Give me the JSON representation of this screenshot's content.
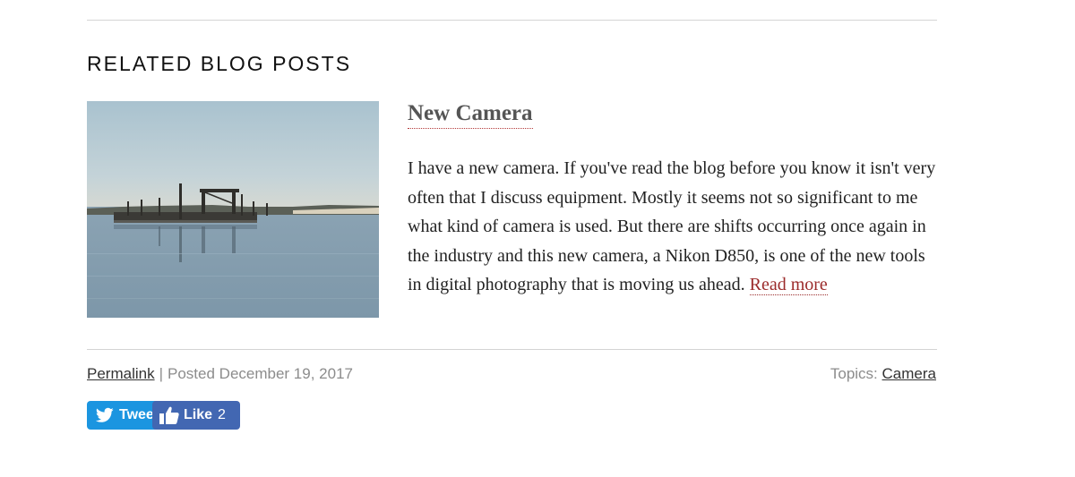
{
  "related": {
    "heading": "RELATED BLOG POSTS"
  },
  "post": {
    "title": "New Camera",
    "image_subject": "pier-over-calm-water-photo",
    "excerpt": "I have a new camera. If you've read the blog before you know it isn't very often that I discuss equipment. Mostly it seems not so significant to me what kind of camera is used. But there are shifts occurring once again in the industry and this new camera, a Nikon D850, is one of the new tools in digital photography that is moving us ahead.",
    "read_more": "Read more"
  },
  "meta": {
    "permalink": "Permalink",
    "separator": "|",
    "posted": "Posted December 19, 2017",
    "topics_label": "Topics:",
    "topic": "Camera"
  },
  "share": {
    "tweet_label": "Tweet",
    "like_label": "Like",
    "like_count": "2",
    "twitter_color": "#1b95e0",
    "facebook_color": "#4267b2"
  },
  "colors": {
    "link_accent": "#9b2b2b",
    "title_text": "#555555",
    "meta_text": "#8c8c8c"
  }
}
